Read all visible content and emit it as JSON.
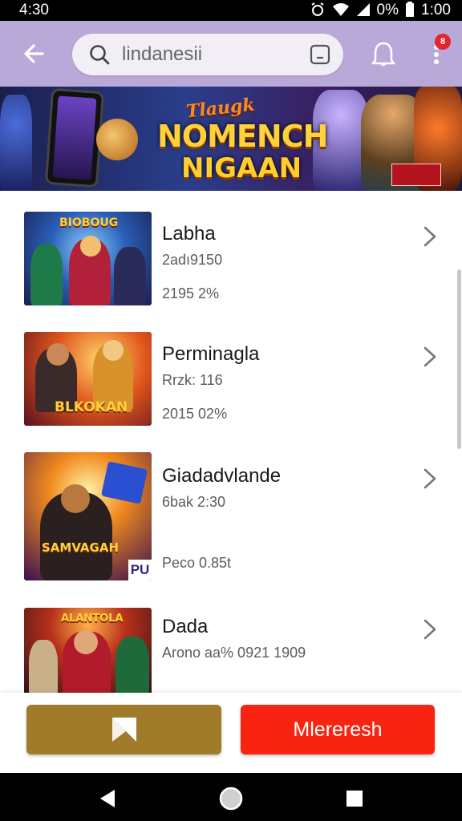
{
  "status_bar": {
    "time_left": "4:30",
    "battery_text": "0%",
    "time_right": "1:00",
    "icons": [
      "alarm-icon",
      "wifi-icon",
      "signal-icon",
      "battery-icon"
    ]
  },
  "app_bar": {
    "search_value": "lindanesii",
    "notification_count": "8",
    "icons": [
      "back-arrow-icon",
      "search-icon",
      "scan-icon",
      "bell-icon",
      "more-vert-icon"
    ],
    "accent": "#b9a9d8"
  },
  "banner": {
    "title_line1": "Tlaugk",
    "title_line2": "NOMENCH",
    "title_line3": "NIGAAN"
  },
  "items": [
    {
      "title": "Labha",
      "subtitle": "2adı9150",
      "meta": "2195  2%"
    },
    {
      "title": "Perminagla",
      "subtitle": "Rrzk: 116",
      "meta": "2015  02%"
    },
    {
      "title": "Giadadvlande",
      "subtitle": "6bak 2:30",
      "meta": "Peco  0.85t",
      "thumb_badge": "PU"
    },
    {
      "title": "Dada",
      "subtitle": "Arono aa% 0921 1909",
      "meta": ""
    }
  ],
  "thumb_logos": [
    "BIOBOUG",
    "BLKOKAN",
    "SAMVAGAH",
    "ALANTOLA"
  ],
  "bottom_bar": {
    "primary_label": "Mlereresh",
    "secondary_icon": "play-store-icon",
    "primary_color": "#f82411",
    "secondary_color": "#a07c2a"
  },
  "nav_bar": {
    "icons": [
      "nav-back-icon",
      "nav-home-icon",
      "nav-recents-icon"
    ]
  }
}
